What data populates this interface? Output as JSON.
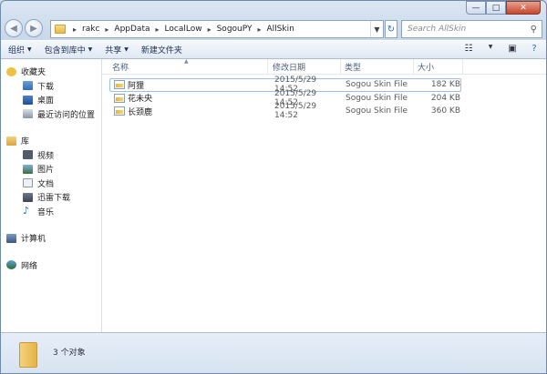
{
  "window": {
    "min": "—",
    "max": "□",
    "close": "✕"
  },
  "nav": {
    "back": "◀",
    "forward": "▶",
    "breadcrumbs": [
      "rakc",
      "AppData",
      "LocalLow",
      "SogouPY",
      "AllSkin"
    ],
    "search_placeholder": "Search AllSkin"
  },
  "toolbar": {
    "organize": "组织",
    "include": "包含到库中",
    "share": "共享",
    "new_folder": "新建文件夹"
  },
  "sidebar": {
    "favorites": "收藏夹",
    "fav_items": [
      "下载",
      "桌面",
      "最近访问的位置"
    ],
    "library": "库",
    "lib_items": [
      "视频",
      "图片",
      "文档",
      "迅雷下载",
      "音乐"
    ],
    "computer": "计算机",
    "network": "网络"
  },
  "columns": {
    "name": "名称",
    "date": "修改日期",
    "type": "类型",
    "size": "大小"
  },
  "files": [
    {
      "name": "阿狸",
      "date": "2015/5/29 14:52",
      "type": "Sogou Skin File",
      "size": "182 KB"
    },
    {
      "name": "花未央",
      "date": "2015/5/29 14:52",
      "type": "Sogou Skin File",
      "size": "204 KB"
    },
    {
      "name": "长颈鹿",
      "date": "2015/5/29 14:52",
      "type": "Sogou Skin File",
      "size": "360 KB"
    }
  ],
  "status": {
    "count": "3 个对象"
  },
  "colors": {
    "accent": "#2b6cc4",
    "folder": "#e6b448"
  }
}
